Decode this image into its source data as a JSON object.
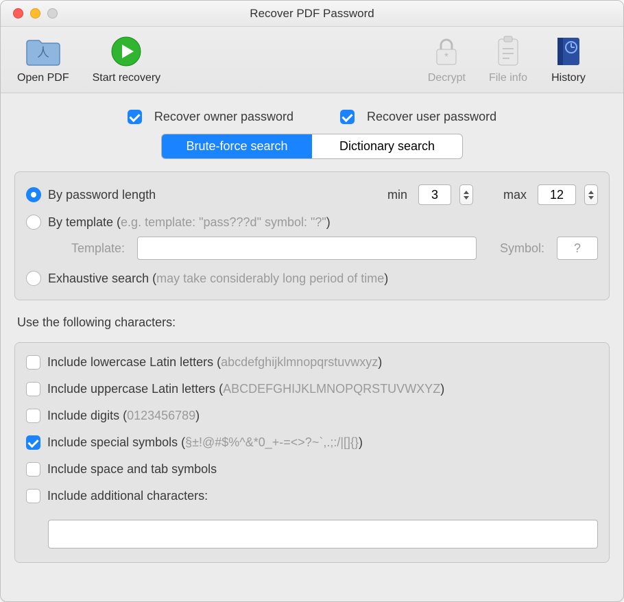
{
  "window": {
    "title": "Recover PDF Password"
  },
  "toolbar": {
    "open_pdf": "Open PDF",
    "start_recovery": "Start recovery",
    "decrypt": "Decrypt",
    "file_info": "File info",
    "history": "History"
  },
  "recover_options": {
    "owner_label": "Recover owner password",
    "owner_checked": true,
    "user_label": "Recover user password",
    "user_checked": true
  },
  "tabs": {
    "brute": "Brute-force search",
    "dict": "Dictionary search",
    "active": "brute"
  },
  "method": {
    "by_length_label": "By password length",
    "by_length_selected": true,
    "min_label": "min",
    "min_value": "3",
    "max_label": "max",
    "max_value": "12",
    "by_template_label": "By template (",
    "by_template_hint": "e.g. template: \"pass???d\" symbol: \"?\"",
    "by_template_close": ")",
    "template_label": "Template:",
    "template_value": "",
    "symbol_label": "Symbol:",
    "symbol_value": "?",
    "exhaustive_label": "Exhaustive search (",
    "exhaustive_hint": "may take considerably long period of time",
    "exhaustive_close": ")"
  },
  "chars_heading": "Use the following characters:",
  "chars": {
    "lower_label": "Include lowercase Latin letters (",
    "lower_hint": "abcdefghijklmnopqrstuvwxyz",
    "lower_close": ")",
    "lower_checked": false,
    "upper_label": "Include uppercase Latin letters (",
    "upper_hint": "ABCDEFGHIJKLMNOPQRSTUVWXYZ",
    "upper_close": ")",
    "upper_checked": false,
    "digits_label": "Include digits (",
    "digits_hint": "0123456789",
    "digits_close": ")",
    "digits_checked": false,
    "special_label": "Include special symbols (",
    "special_hint": "§±!@#$%^&*0_+-=<>?~`,.;:/|[]{}",
    "special_close": ")",
    "special_checked": true,
    "space_label": "Include space and tab symbols",
    "space_checked": false,
    "additional_label": "Include additional characters:",
    "additional_checked": false,
    "additional_value": ""
  }
}
